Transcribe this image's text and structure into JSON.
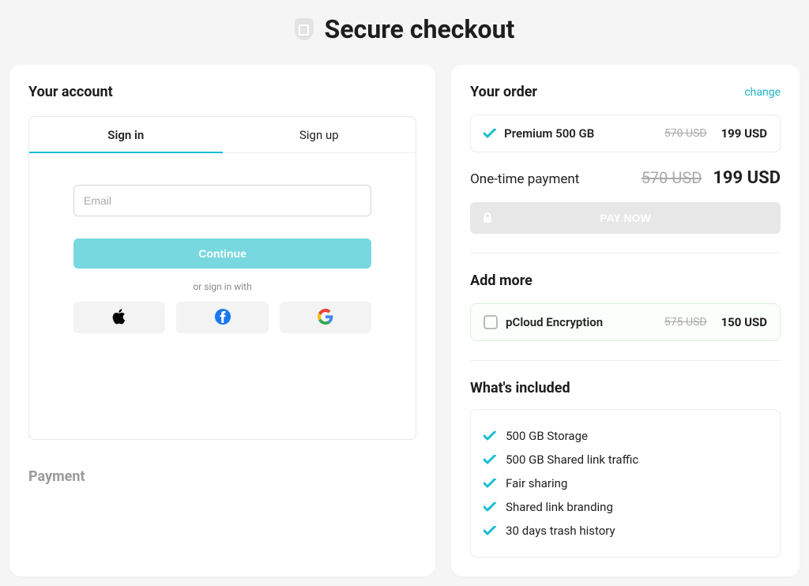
{
  "header": {
    "title": "Secure checkout"
  },
  "account": {
    "title": "Your account",
    "tab_signin": "Sign in",
    "tab_signup": "Sign up",
    "email_placeholder": "Email",
    "continue_label": "Continue",
    "sso_divider": "or sign in with"
  },
  "payment_heading": "Payment",
  "order": {
    "title": "Your order",
    "change_label": "change",
    "item_label": "Premium 500 GB",
    "item_old": "570 USD",
    "item_new": "199 USD",
    "total_label": "One-time payment",
    "total_old": "570 USD",
    "total_new": "199 USD",
    "paynow_label": "PAY NOW"
  },
  "addmore": {
    "title": "Add more",
    "item_label": "pCloud Encryption",
    "item_old": "575 USD",
    "item_new": "150 USD"
  },
  "included": {
    "title": "What's included",
    "items": [
      "500 GB Storage",
      "500 GB Shared link traffic",
      "Fair sharing",
      "Shared link branding",
      "30 days trash history"
    ]
  }
}
